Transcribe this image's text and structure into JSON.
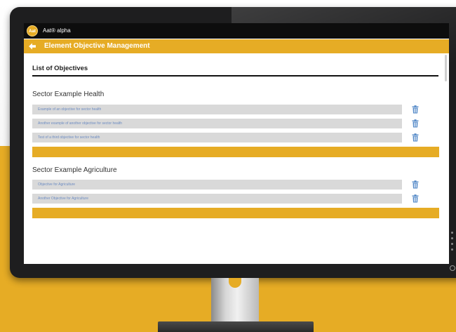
{
  "colors": {
    "accent": "#e6ac25",
    "app_bar": "#0d0d0d",
    "objective_bg": "#d9d9d9",
    "objective_text": "#6d8cc2",
    "delete_icon": "#4f86c6"
  },
  "app": {
    "logo_text": "Aat",
    "name": "Aat® alpha"
  },
  "header": {
    "back_icon": "arrow-left-icon",
    "title": "Element Objective Management"
  },
  "main": {
    "list_heading": "List of Objectives",
    "sectors": [
      {
        "title": "Sector Example Health",
        "objectives": [
          "Example of an objective for sector health",
          "Another example of another objective for sector health",
          "Test of a third objective for sector health"
        ]
      },
      {
        "title": "Sector Example Agriculture",
        "objectives": [
          "Objective for Agriculture",
          "Another Objective for Agriculture"
        ]
      }
    ]
  }
}
